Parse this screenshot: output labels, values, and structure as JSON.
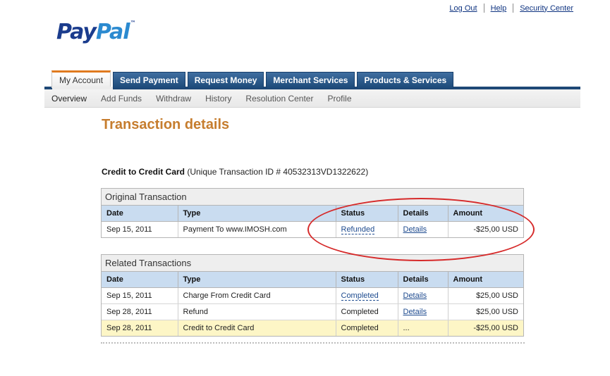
{
  "util_links": [
    "Log Out",
    "Help",
    "Security Center"
  ],
  "logo": {
    "part1": "Pay",
    "part2": "Pal",
    "tm": "™"
  },
  "tabs": [
    "My Account",
    "Send Payment",
    "Request Money",
    "Merchant Services",
    "Products & Services"
  ],
  "subnav": [
    "Overview",
    "Add Funds",
    "Withdraw",
    "History",
    "Resolution Center",
    "Profile"
  ],
  "page_title": "Transaction details",
  "heading": {
    "bold": "Credit to Credit Card",
    "rest": " (Unique Transaction ID # 40532313VD1322622)"
  },
  "columns": [
    "Date",
    "Type",
    "Status",
    "Details",
    "Amount"
  ],
  "original": {
    "caption": "Original Transaction",
    "rows": [
      {
        "date": "Sep 15, 2011",
        "type": "Payment To www.IMOSH.com",
        "status": "Refunded",
        "details": "Details",
        "amount": "-$25,00 USD"
      }
    ]
  },
  "related": {
    "caption": "Related Transactions",
    "rows": [
      {
        "date": "Sep 15, 2011",
        "type": "Charge From Credit Card",
        "status": "Completed",
        "details": "Details",
        "amount": "$25,00 USD"
      },
      {
        "date": "Sep 28, 2011",
        "type": "Refund",
        "status": "Completed",
        "details": "Details",
        "amount": "$25,00 USD"
      },
      {
        "date": "Sep 28, 2011",
        "type": "Credit to Credit Card",
        "status": "Completed",
        "details": "...",
        "amount": "-$25,00 USD"
      }
    ]
  },
  "colors": {
    "accent_orange": "#c67d2e",
    "tab_blue": "#1e4876",
    "header_blue": "#c9dcf0",
    "highlight_row": "#fdf6c6",
    "annotation_red": "#d62a2a"
  }
}
